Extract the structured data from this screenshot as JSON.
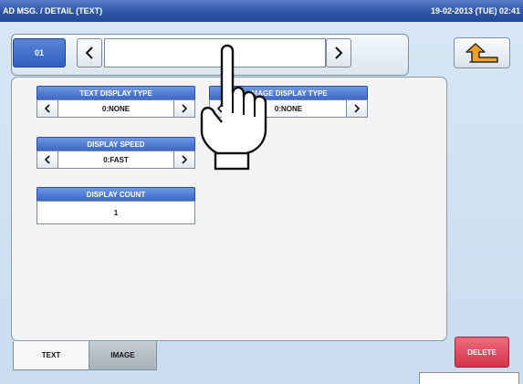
{
  "title_bar": {
    "title": "AD MSG. / DETAIL (TEXT)",
    "datetime": "19-02-2013 (TUE) 02:41"
  },
  "nav": {
    "number": "01",
    "value": ""
  },
  "fields": {
    "text_display_type": {
      "label": "TEXT DISPLAY TYPE",
      "value": "0:NONE"
    },
    "image_display_type": {
      "label": "IMAGE DISPLAY TYPE",
      "value": "0:NONE"
    },
    "display_speed": {
      "label": "DISPLAY SPEED",
      "value": "0:FAST"
    },
    "display_count": {
      "label": "DISPLAY COUNT",
      "value": "1"
    }
  },
  "tabs": [
    {
      "label": "TEXT",
      "active": true
    },
    {
      "label": "IMAGE",
      "active": false
    }
  ],
  "buttons": {
    "delete": "DELETE"
  },
  "icons": {
    "back": "return-arrow-icon",
    "prev": "chevron-left-icon",
    "next": "chevron-right-icon",
    "pointer": "pointing-hand-icon"
  },
  "colors": {
    "title_bar": "#2f56a8",
    "field_header": "#3c68c8",
    "delete": "#d6334c",
    "back_arrow": "#f0a020"
  }
}
